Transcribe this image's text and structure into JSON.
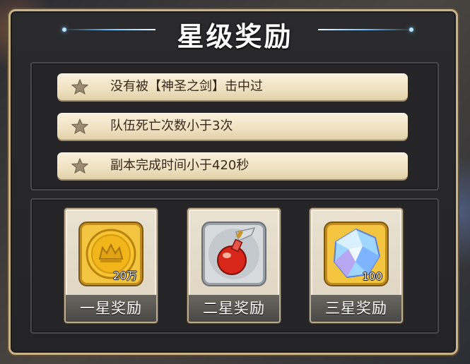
{
  "title": "星级奖励",
  "conditions": [
    {
      "text": "没有被【神圣之剑】击中过"
    },
    {
      "text": "队伍死亡次数小于3次"
    },
    {
      "text": "副本完成时间小于420秒"
    }
  ],
  "rewards": [
    {
      "label": "一星奖励",
      "item_icon": "gold-coin-icon",
      "qty": "20万"
    },
    {
      "label": "二星奖励",
      "item_icon": "potion-flask-icon",
      "qty": ""
    },
    {
      "label": "三星奖励",
      "item_icon": "diamond-gem-icon",
      "qty": "100"
    }
  ],
  "colors": {
    "panel_border": "#c9b48a",
    "condition_bg": "#efe1c1",
    "condition_text": "#3b2a1c",
    "title_line": "#6fc2ff"
  }
}
